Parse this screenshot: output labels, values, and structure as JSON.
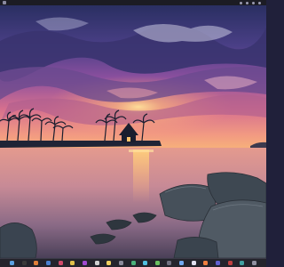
{
  "wallpaper": {
    "scene": "sunset-beach",
    "colors": {
      "sky_top": "#2a2f62",
      "sky_mid": "#8a4f9e",
      "horizon": "#f29a82",
      "glow": "#ffd27a",
      "sea": "#d98a8a",
      "sea_dark": "#5a4a6a",
      "rock": "#3a4450"
    }
  },
  "topbar": {
    "icon": "menu-icon",
    "tray_icons": [
      "network-icon",
      "volume-icon",
      "battery-icon",
      "power-icon"
    ]
  },
  "dock": {
    "icons": [
      {
        "name": "files",
        "color": "#5aa0e0"
      },
      {
        "name": "terminal",
        "color": "#3a3a3a"
      },
      {
        "name": "browser",
        "color": "#e0803a"
      },
      {
        "name": "mail",
        "color": "#4a80d0"
      },
      {
        "name": "music",
        "color": "#d04a6a"
      },
      {
        "name": "photos",
        "color": "#e0c04a"
      },
      {
        "name": "video",
        "color": "#a04ad0"
      },
      {
        "name": "calendar",
        "color": "#d0d0d0"
      },
      {
        "name": "notes",
        "color": "#f0d060"
      },
      {
        "name": "settings",
        "color": "#8a8a9a"
      },
      {
        "name": "store",
        "color": "#4ab07a"
      },
      {
        "name": "chat",
        "color": "#50c0e0"
      },
      {
        "name": "maps",
        "color": "#6ac060"
      },
      {
        "name": "camera",
        "color": "#707080"
      },
      {
        "name": "weather",
        "color": "#70a8f0"
      },
      {
        "name": "clock",
        "color": "#e0e0f0"
      },
      {
        "name": "calculator",
        "color": "#f08040"
      },
      {
        "name": "editor",
        "color": "#6060d0"
      },
      {
        "name": "games",
        "color": "#c04040"
      },
      {
        "name": "downloads",
        "color": "#40a0a0"
      },
      {
        "name": "trash",
        "color": "#9090a0"
      }
    ]
  }
}
